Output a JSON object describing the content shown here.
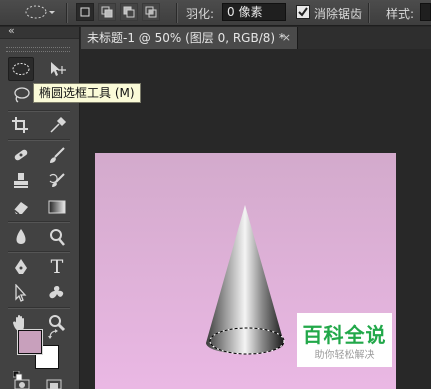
{
  "options_bar": {
    "feather_label": "羽化:",
    "feather_value": "0 像素",
    "antialias_label": "消除锯齿",
    "antialias_checked": true,
    "style_label": "样式:"
  },
  "document_tab": {
    "title": "未标题-1 @ 50% (图层 0, RGB/8) *",
    "close": "×"
  },
  "tooltip": {
    "text": "椭圆选框工具 (M)"
  },
  "toolbar": {
    "collapse_arrows": "«",
    "type_tool_glyph": "T",
    "foreground_color": "#c8a0bc",
    "background_color": "#ffffff"
  },
  "canvas": {
    "gradient_top": "#d3aacc",
    "gradient_bottom": "#eab8e4"
  },
  "watermark": {
    "title": "百科全说",
    "subtitle": "助你轻松解决",
    "color": "#22a84a"
  }
}
